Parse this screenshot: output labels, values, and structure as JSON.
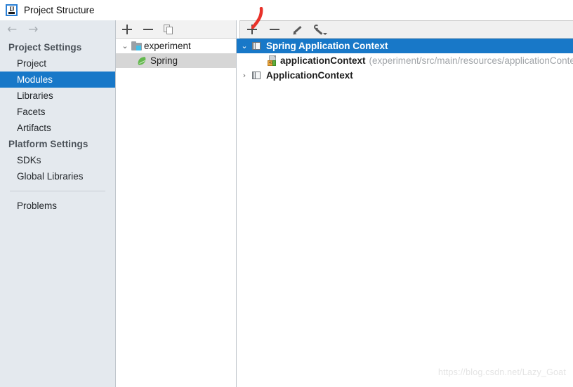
{
  "window": {
    "title": "Project Structure",
    "app_icon": "intellij-idea-icon",
    "ij_glyph": "IJ"
  },
  "navigation": {
    "back_icon": "arrow-left-icon",
    "back_glyph": "←",
    "forward_icon": "arrow-right-icon",
    "forward_glyph": "→"
  },
  "sidebar": {
    "groups": [
      {
        "label": "Project Settings",
        "items": [
          {
            "label": "Project",
            "selected": false
          },
          {
            "label": "Modules",
            "selected": true
          },
          {
            "label": "Libraries",
            "selected": false
          },
          {
            "label": "Facets",
            "selected": false
          },
          {
            "label": "Artifacts",
            "selected": false
          }
        ]
      },
      {
        "label": "Platform Settings",
        "items": [
          {
            "label": "SDKs",
            "selected": false
          },
          {
            "label": "Global Libraries",
            "selected": false
          }
        ]
      }
    ],
    "footer_item": {
      "label": "Problems"
    }
  },
  "middle_panel": {
    "toolbar": [
      {
        "name": "add-module-button",
        "icon": "plus-icon",
        "tooltip": "Add"
      },
      {
        "name": "remove-module-button",
        "icon": "minus-icon",
        "tooltip": "Remove"
      },
      {
        "name": "copy-module-button",
        "icon": "copy-icon",
        "tooltip": "Copy"
      }
    ],
    "tree": {
      "module": {
        "label": "experiment",
        "icon": "module-folder-icon",
        "expanded": true,
        "chevron": "⌄"
      },
      "facet": {
        "label": "Spring",
        "icon": "spring-leaf-icon",
        "selected": true
      }
    }
  },
  "right_panel": {
    "toolbar": [
      {
        "name": "add-context-button",
        "icon": "plus-icon",
        "tooltip": "Add"
      },
      {
        "name": "remove-context-button",
        "icon": "minus-icon",
        "tooltip": "Remove"
      },
      {
        "name": "edit-context-button",
        "icon": "pencil-icon",
        "tooltip": "Edit"
      },
      {
        "name": "settings-context-button",
        "icon": "wrench-icon",
        "tooltip": "Settings"
      }
    ],
    "contexts": [
      {
        "label": "Spring Application Context",
        "icon": "stacked-documents-icon",
        "expanded": true,
        "chevron": "⌄",
        "selected": true,
        "children": [
          {
            "name": "applicationContext",
            "path": "(experiment/src/main/resources/applicationContext)",
            "icon": "xml-file-icon",
            "badge_text": "<>"
          }
        ]
      },
      {
        "label": "ApplicationContext",
        "icon": "stacked-documents-icon",
        "expanded": false,
        "chevron": "›",
        "selected": false,
        "children": []
      }
    ]
  },
  "annotation": {
    "name": "red-pen-stroke",
    "color": "#e8322a",
    "points_at": "add-context-button"
  },
  "watermark": {
    "text": "https://blog.csdn.net/Lazy_Goat"
  },
  "colors": {
    "selection_blue": "#1878c8",
    "sidebar_bg": "#e4e9ee",
    "toolbar_bg": "#f0f0f0",
    "tree_selected_gray": "#d6d6d6",
    "annotation_red": "#e8322a",
    "path_gray": "#a0a4a8"
  }
}
